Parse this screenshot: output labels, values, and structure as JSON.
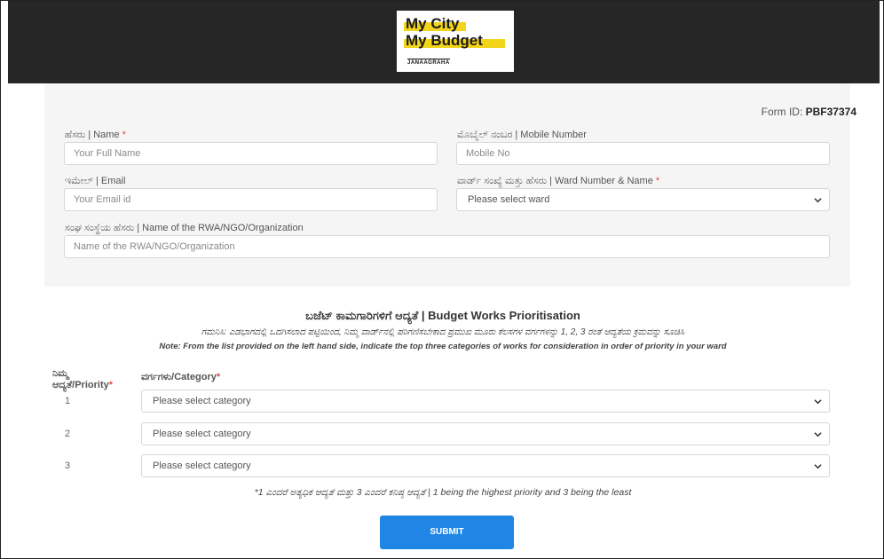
{
  "logo": {
    "line1": "My City",
    "line2": "My Budget",
    "sub": "JANAAGRAHA",
    "accent": "#f2d41a"
  },
  "form": {
    "form_id_label": "Form ID:",
    "form_id_value": "PBF37374",
    "name_label": "ಹೆಸರು | Name",
    "name_placeholder": "Your Full Name",
    "mobile_label": "ಮೊಬೈಲ್ ನಂಬರ | Mobile Number",
    "mobile_placeholder": "Mobile No",
    "email_label": "ಇಮೇಲ್ | Email",
    "email_placeholder": "Your Email id",
    "ward_label": "ವಾರ್ಡ್ ಸಂಖ್ಯೆ ಮತ್ತು ಹೆಸರು | Ward Number & Name",
    "ward_selected": "Please select ward",
    "org_label": "ಸಂಘ ಸಂಸ್ಥೆಯ ಹೆಸರು | Name of the RWA/NGO/Organization",
    "org_placeholder": "Name of the RWA/NGO/Organization",
    "required_mark": "*"
  },
  "prioritisation": {
    "title": "ಬಜೆಟ್ ಕಾಮಗಾರಿಗಳಿಗೆ ಆದ್ಯತೆ | Budget Works Prioritisation",
    "note_kannada": "ಗಮನಿಸಿ: ಎಡಭಾಗದಲ್ಲಿ ಒದಗಿಸಲಾದ ಪಟ್ಟಿಯಿಂದ, ನಿಮ್ಮ ವಾರ್ಡ್‌ನಲ್ಲಿ ಪರಿಗಣಿಸಬೇಕಾದ ಪ್ರಮುಖ ಮೂರು ಕೆಲಸಗಳ ವರ್ಗಗಳನ್ನು 1, 2, 3 ರಂತೆ ಆದ್ಯತೆಯ ಕ್ರಮವನ್ನು ಸೂಚಿಸಿ",
    "note_english": "Note: From the list provided on the left hand side, indicate the top three categories of works for consideration in order of priority in your ward",
    "priority_header_line1": "ನಿಮ್ಮ",
    "priority_header_line2": "ಆದ್ಯತೆ/Priority",
    "category_header": "ವರ್ಗಗಳು/Category",
    "rows": [
      {
        "num": "1",
        "selected": "Please select category"
      },
      {
        "num": "2",
        "selected": "Please select category"
      },
      {
        "num": "3",
        "selected": "Please select category"
      }
    ],
    "footnote": "*1 ಎಂದರೆ ಅತ್ಯಧಿಕ ಆದ್ಯತೆ ಮತ್ತು 3 ಎಂದರೆ ಕನಿಷ್ಠ ಆದ್ಯತೆ | 1 being the highest priority and 3 being the least",
    "submit_label": "SUBMIT"
  }
}
